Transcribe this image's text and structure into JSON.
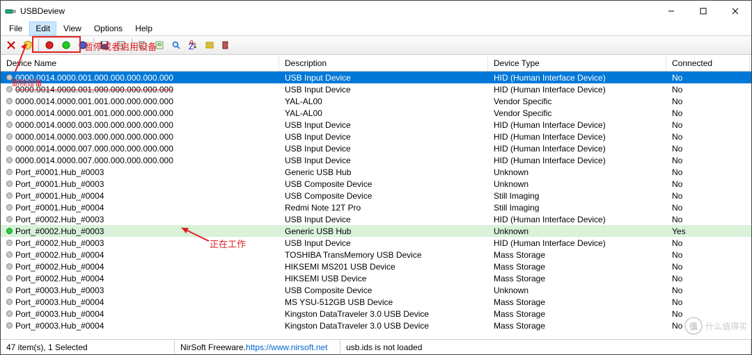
{
  "app": {
    "title": "USBDeview"
  },
  "menu": {
    "file": "File",
    "edit": "Edit",
    "view": "View",
    "options": "Options",
    "help": "Help"
  },
  "annotations": {
    "toggle": "暂停或者启用设备",
    "delete": "删除设备",
    "working": "正在工作"
  },
  "columns": {
    "name": "Device Name",
    "description": "Description",
    "type": "Device Type",
    "connected": "Connected"
  },
  "rows": [
    {
      "name": "0000.0014.0000.001.000.000.000.000.000",
      "desc": "USB Input Device",
      "type": "HID (Human Interface Device)",
      "conn": "No",
      "sel": true
    },
    {
      "name": "0000.0014.0000.001.000.000.000.000.000",
      "desc": "USB Input Device",
      "type": "HID (Human Interface Device)",
      "conn": "No",
      "struck": true
    },
    {
      "name": "0000.0014.0000.001.001.000.000.000.000",
      "desc": "YAL-AL00",
      "type": "Vendor Specific",
      "conn": "No"
    },
    {
      "name": "0000.0014.0000.001.001.000.000.000.000",
      "desc": "YAL-AL00",
      "type": "Vendor Specific",
      "conn": "No"
    },
    {
      "name": "0000.0014.0000.003.000.000.000.000.000",
      "desc": "USB Input Device",
      "type": "HID (Human Interface Device)",
      "conn": "No"
    },
    {
      "name": "0000.0014.0000.003.000.000.000.000.000",
      "desc": "USB Input Device",
      "type": "HID (Human Interface Device)",
      "conn": "No"
    },
    {
      "name": "0000.0014.0000.007.000.000.000.000.000",
      "desc": "USB Input Device",
      "type": "HID (Human Interface Device)",
      "conn": "No"
    },
    {
      "name": "0000.0014.0000.007.000.000.000.000.000",
      "desc": "USB Input Device",
      "type": "HID (Human Interface Device)",
      "conn": "No"
    },
    {
      "name": "Port_#0001.Hub_#0003",
      "desc": "Generic USB Hub",
      "type": "Unknown",
      "conn": "No"
    },
    {
      "name": "Port_#0001.Hub_#0003",
      "desc": "USB Composite Device",
      "type": "Unknown",
      "conn": "No"
    },
    {
      "name": "Port_#0001.Hub_#0004",
      "desc": "USB Composite Device",
      "type": "Still Imaging",
      "conn": "No"
    },
    {
      "name": "Port_#0001.Hub_#0004",
      "desc": "Redmi Note 12T Pro",
      "type": "Still Imaging",
      "conn": "No"
    },
    {
      "name": "Port_#0002.Hub_#0003",
      "desc": "USB Input Device",
      "type": "HID (Human Interface Device)",
      "conn": "No"
    },
    {
      "name": "Port_#0002.Hub_#0003",
      "desc": "Generic USB Hub",
      "type": "Unknown",
      "conn": "Yes",
      "active": true
    },
    {
      "name": "Port_#0002.Hub_#0003",
      "desc": "USB Input Device",
      "type": "HID (Human Interface Device)",
      "conn": "No"
    },
    {
      "name": "Port_#0002.Hub_#0004",
      "desc": "TOSHIBA TransMemory USB Device",
      "type": "Mass Storage",
      "conn": "No"
    },
    {
      "name": "Port_#0002.Hub_#0004",
      "desc": "HIKSEMI MS201 USB Device",
      "type": "Mass Storage",
      "conn": "No"
    },
    {
      "name": "Port_#0002.Hub_#0004",
      "desc": "HIKSEMI USB Device",
      "type": "Mass Storage",
      "conn": "No"
    },
    {
      "name": "Port_#0003.Hub_#0003",
      "desc": "USB Composite Device",
      "type": "Unknown",
      "conn": "No"
    },
    {
      "name": "Port_#0003.Hub_#0004",
      "desc": "MS YSU-512GB USB Device",
      "type": "Mass Storage",
      "conn": "No"
    },
    {
      "name": "Port_#0003.Hub_#0004",
      "desc": "Kingston DataTraveler 3.0 USB Device",
      "type": "Mass Storage",
      "conn": "No"
    },
    {
      "name": "Port_#0003.Hub_#0004",
      "desc": "Kingston DataTraveler 3.0 USB Device",
      "type": "Mass Storage",
      "conn": "No"
    }
  ],
  "status": {
    "count": "47 item(s), 1 Selected",
    "vendor_prefix": "NirSoft Freeware.  ",
    "vendor_link": "https://www.nirsoft.net",
    "ids": "usb.ids is not loaded"
  },
  "watermark": "什么值得买"
}
